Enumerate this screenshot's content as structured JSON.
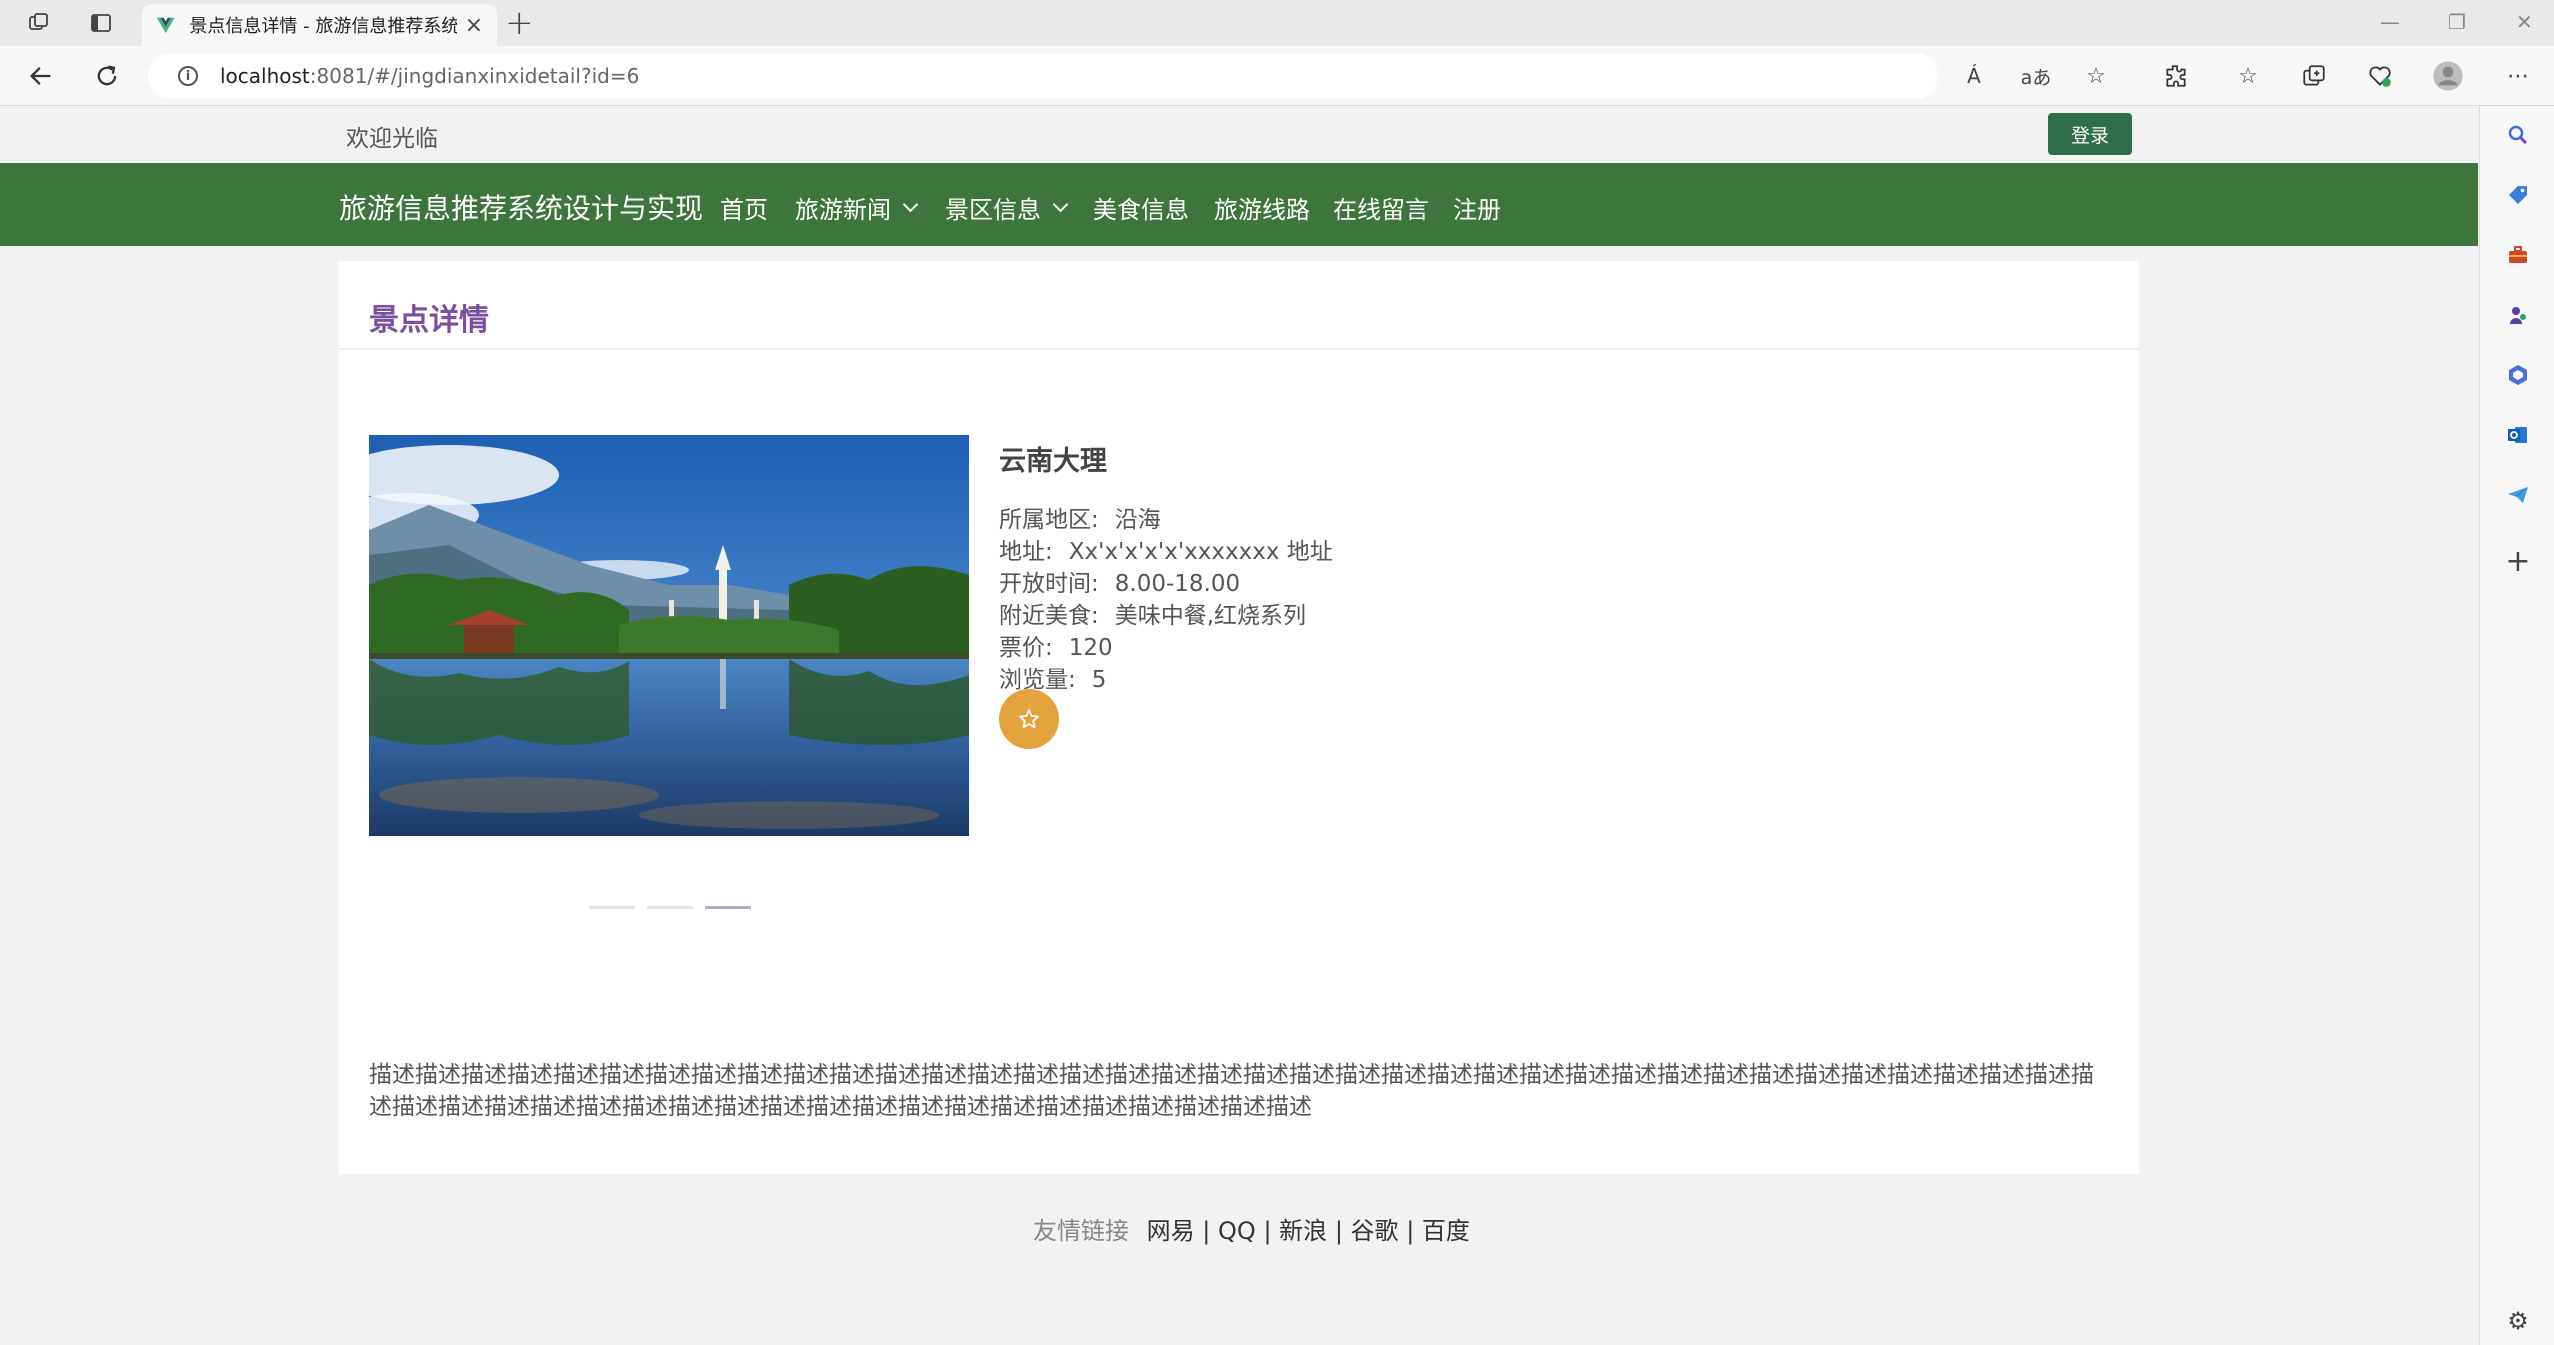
{
  "browser": {
    "tab_title": "景点信息详情 - 旅游信息推荐系统设计与实现",
    "tab_close": "×",
    "new_tab": "+",
    "url_host": "localhost",
    "url_rest": ":8081/#/jingdianxinxidetail?id=6",
    "read_aloud": "Á",
    "translate": "aあ"
  },
  "site": {
    "welcome": "欢迎光临",
    "login_label": "登录",
    "brand": "旅游信息推荐系统设计与实现",
    "nav": [
      "首页",
      "旅游新闻",
      "景区信息",
      "美食信息",
      "旅游线路",
      "在线留言",
      "注册"
    ]
  },
  "detail": {
    "section_title": "景点详情",
    "name": "云南大理",
    "fields": [
      {
        "label": "所属地区:",
        "value": "沿海"
      },
      {
        "label": "地址:",
        "value": "Xx'x'x'x'x'xxxxxxx 地址"
      },
      {
        "label": "开放时间:",
        "value": "8.00-18.00"
      },
      {
        "label": "附近美食:",
        "value": "美味中餐,红烧系列"
      },
      {
        "label": "票价:",
        "value": "120"
      },
      {
        "label": "浏览量:",
        "value": "5"
      }
    ],
    "carousel_active_index": 2,
    "description": "描述描述描述描述描述描述描述描述描述描述描述描述描述描述描述描述描述描述描述描述描述描述描述描述描述描述描述描述描述描述描述描述描述描述描述描述描述描述描述描述描述描述描述描述描述描述描述描述描述描述描述描述描述描述描述描述描述描述"
  },
  "footer": {
    "label": "友情链接",
    "links": [
      "网易",
      "QQ",
      "新浪",
      "谷歌",
      "百度"
    ],
    "separator": "|"
  },
  "colors": {
    "navbar": "#3c763d",
    "login_button": "#2e6e4a",
    "section_title": "#7b4fa0",
    "favorite_button": "#e3a23b"
  }
}
